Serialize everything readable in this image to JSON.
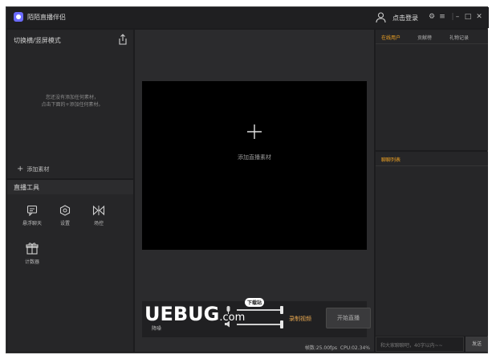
{
  "app": {
    "title": "陌陌直播伴侣",
    "login_label": "点击登录",
    "window_icons": [
      "settings-icon",
      "menu-icon",
      "minimize-icon",
      "maximize-icon",
      "close-icon"
    ]
  },
  "left_panel": {
    "mode_header": "切换横/竖屏模式",
    "empty_hint": "您还没有添加任何素材，\n点击下面的+添加任何素材。",
    "add_material_label": "添加素材",
    "tools_header": "直播工具",
    "tools": [
      {
        "label": "悬浮聊天",
        "icon": "chat-float-icon"
      },
      {
        "label": "设置",
        "icon": "settings-hex-icon"
      },
      {
        "label": "场控",
        "icon": "bowtie-icon"
      },
      {
        "label": "计数器",
        "icon": "gift-icon"
      }
    ]
  },
  "center": {
    "add_live_material": "添加直播素材",
    "noise_label": "降噪",
    "record_video_label": "录制视频",
    "start_live_label": "开始直播",
    "fps_label": "帧数:25.00fps",
    "cpu_label": "CPU:02.34%",
    "watermark_text": "UEBUG",
    "watermark_domain": ".com",
    "watermark_badge": "下载站"
  },
  "right_panel": {
    "tabs": [
      {
        "label": "在线用户",
        "active": true
      },
      {
        "label": "贡献榜",
        "active": false
      },
      {
        "label": "礼物记录",
        "active": false
      }
    ],
    "chat_header": "聊聊列表",
    "chat_placeholder": "和大家聊聊吧，40字以内~~",
    "send_label": "发送"
  },
  "colors": {
    "accent": "#f5a623",
    "record": "#e8a850",
    "background": "#1c1c1e",
    "panel": "#262628"
  }
}
